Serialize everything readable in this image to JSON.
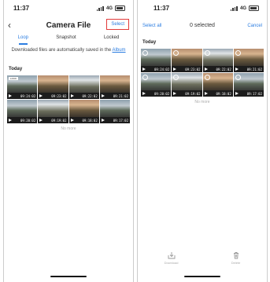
{
  "left": {
    "status": {
      "time": "11:37",
      "network": "4G"
    },
    "nav": {
      "back": "‹",
      "title": "Camera File",
      "select": "Select"
    },
    "tabs": [
      {
        "label": "Loop"
      },
      {
        "label": "Snapshot"
      },
      {
        "label": "Locked"
      }
    ],
    "notice": {
      "text": "Downloaded files are automatically saved in the ",
      "link": "Album"
    },
    "section": "Today",
    "thumbs": [
      {
        "duration": "09:24:02",
        "tag": "LOCK"
      },
      {
        "duration": "09:23:02",
        "tag": ""
      },
      {
        "duration": "09:22:02",
        "tag": ""
      },
      {
        "duration": "09:21:02",
        "tag": ""
      },
      {
        "duration": "09:20:02",
        "tag": ""
      },
      {
        "duration": "09:19:02",
        "tag": ""
      },
      {
        "duration": "09:18:02",
        "tag": ""
      },
      {
        "duration": "09:17:02",
        "tag": ""
      }
    ],
    "no_more": "No more"
  },
  "right": {
    "status": {
      "time": "11:37",
      "network": "4G"
    },
    "header": {
      "select_all": "Select all",
      "count": "0 selected",
      "cancel": "Cancel"
    },
    "section": "Today",
    "no_more": "No more",
    "actions": {
      "download": "Download",
      "delete": "Delete"
    }
  }
}
